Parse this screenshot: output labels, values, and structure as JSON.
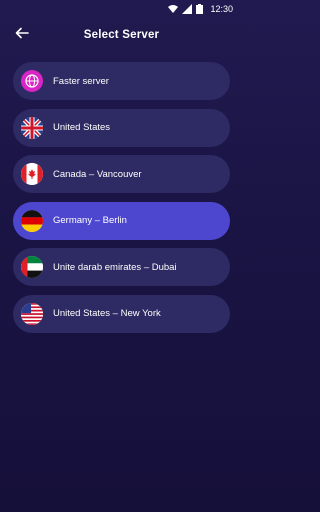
{
  "status": {
    "time": "12:30"
  },
  "header": {
    "title": "Select Server",
    "back_icon": "arrow-left-icon"
  },
  "servers": [
    {
      "label": "Faster server",
      "icon": "globe-icon",
      "selected": false
    },
    {
      "label": "United States",
      "icon": "uk-flag-icon",
      "selected": false
    },
    {
      "label": "Canada – Vancouver",
      "icon": "canada-flag-icon",
      "selected": false
    },
    {
      "label": "Germany – Berlin",
      "icon": "germany-flag-icon",
      "selected": true
    },
    {
      "label": "Unite darab emirates – Dubai",
      "icon": "uae-flag-icon",
      "selected": false
    },
    {
      "label": "United States – New York",
      "icon": "us-flag-icon",
      "selected": false
    }
  ],
  "colors": {
    "background": "#1a1444",
    "item": "#2e2a63",
    "item_selected": "#4d47d0",
    "globe": "#d726c5"
  }
}
